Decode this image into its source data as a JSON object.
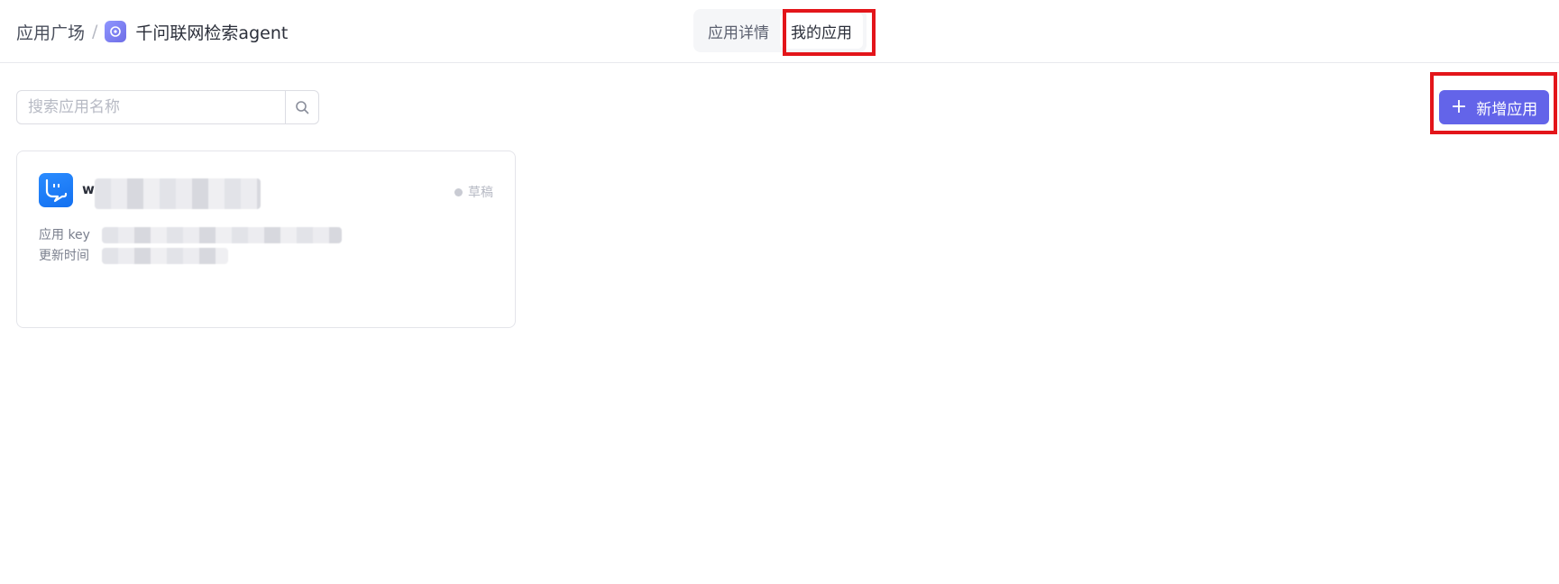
{
  "header": {
    "breadcrumb_root": "应用广场",
    "breadcrumb_separator": "/",
    "breadcrumb_current": "千问联网检索agent",
    "tabs": [
      {
        "label": "应用详情",
        "active": false
      },
      {
        "label": "我的应用",
        "active": true
      }
    ]
  },
  "toolbar": {
    "search_placeholder": "搜索应用名称",
    "new_app_label": "新增应用"
  },
  "card": {
    "name_visible": "w",
    "status": "草稿",
    "app_key_label": "应用 key",
    "updated_label": "更新时间"
  },
  "colors": {
    "accent": "#6364e9",
    "highlight": "#e3151a",
    "card_icon": "#1a7cf5"
  },
  "icons": {
    "app_logo": "chat-sparkle-icon",
    "search": "search-icon",
    "add": "plus-icon",
    "card": "chat-bubble-icon"
  }
}
